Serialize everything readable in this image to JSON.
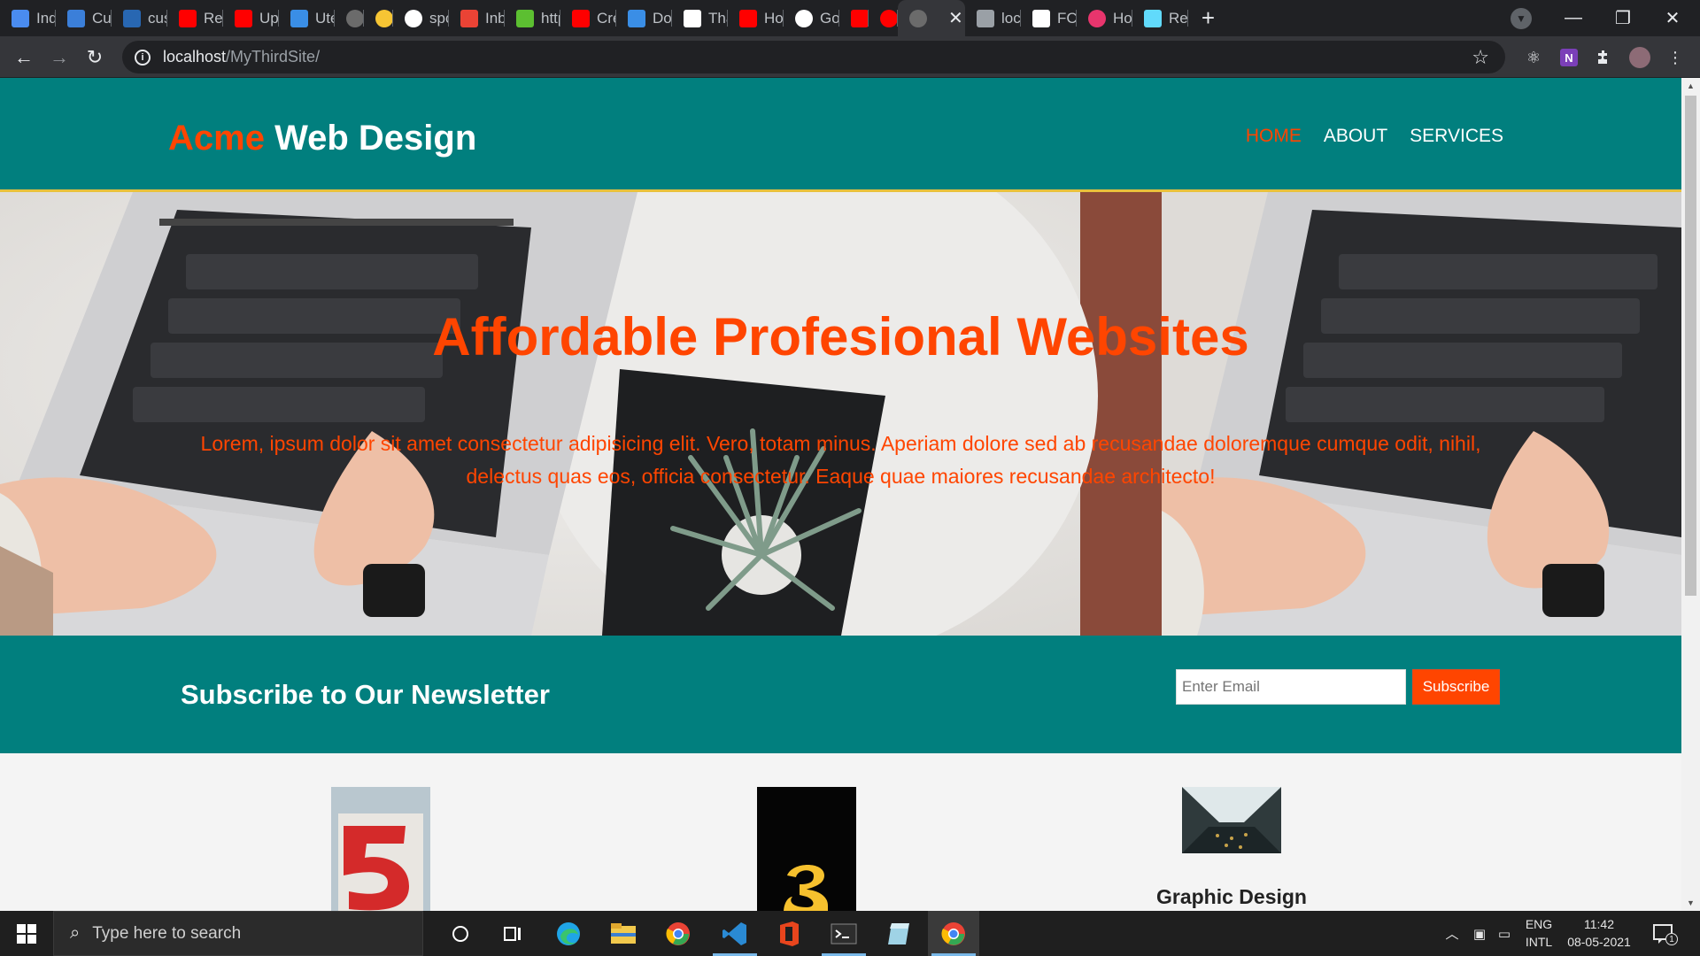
{
  "browser": {
    "tabs": [
      {
        "label": "Inde",
        "icon": "info-icon",
        "color": "#4a8cf0"
      },
      {
        "label": "Cus",
        "icon": "trello-icon",
        "color": "#3b7fd9"
      },
      {
        "label": "cust",
        "icon": "linkedin-icon",
        "color": "#2867b2"
      },
      {
        "label": "Rea",
        "icon": "youtube-icon",
        "color": "#ff0000"
      },
      {
        "label": "Upc",
        "icon": "youtube-icon",
        "color": "#ff0000"
      },
      {
        "label": "Ute",
        "icon": "flag-icon",
        "color": "#3a8ee6"
      },
      {
        "label": "",
        "icon": "globe-icon",
        "color": "#6b6b6b"
      },
      {
        "label": "",
        "icon": "emoji-icon",
        "color": "#f6c534"
      },
      {
        "label": "spo",
        "icon": "spotify-icon",
        "color": "#ffffff"
      },
      {
        "label": "Inb",
        "icon": "gmail-icon",
        "color": "#ea4335"
      },
      {
        "label": "http",
        "icon": "evernote-icon",
        "color": "#5cbf31"
      },
      {
        "label": "Cre",
        "icon": "youtube-icon",
        "color": "#ff0000"
      },
      {
        "label": "Dov",
        "icon": "flag-icon",
        "color": "#3a8ee6"
      },
      {
        "label": "Tha",
        "icon": "doc-icon",
        "color": "#ffffff"
      },
      {
        "label": "Hov",
        "icon": "youtube-icon",
        "color": "#ff0000"
      },
      {
        "label": "Goo",
        "icon": "google-icon",
        "color": "#ffffff"
      },
      {
        "label": "",
        "icon": "youtube-icon",
        "color": "#ff0000"
      },
      {
        "label": "",
        "icon": "record-icon",
        "color": "#ff0000"
      },
      {
        "label": "",
        "icon": "globe-icon",
        "color": "#6b6b6b",
        "active": true
      },
      {
        "label": "loca",
        "icon": "react-icon",
        "color": "#9aa0a6"
      },
      {
        "label": "FCC",
        "icon": "fcc-icon",
        "color": "#ffffff"
      },
      {
        "label": "Hov",
        "icon": "play-icon",
        "color": "#e8356d"
      },
      {
        "label": "Rea",
        "icon": "react-icon",
        "color": "#61dafb"
      }
    ],
    "url_host": "localhost",
    "url_path": "/MyThirdSite/"
  },
  "site": {
    "brand_highlight": "Acme",
    "brand_rest": " Web Design",
    "nav": [
      {
        "label": "HOME",
        "current": true
      },
      {
        "label": "ABOUT",
        "current": false
      },
      {
        "label": "SERVICES",
        "current": false
      }
    ],
    "showcase": {
      "title": "Affordable Profesional Websites",
      "text": "Lorem, ipsum dolor sit amet consectetur adipisicing elit. Vero, totam minus. Aperiam dolore sed ab recusandae doloremque cumque odit, nihil, delectus quas eos, officia consectetur. Eaque quae maiores recusandae architecto!"
    },
    "newsletter": {
      "title": "Subscribe to Our Newsletter",
      "placeholder": "Enter Email",
      "button": "Subscribe"
    },
    "boxes": [
      {
        "title": ""
      },
      {
        "title": ""
      },
      {
        "title": "Graphic Design"
      }
    ],
    "accent_color": "#ff4500",
    "primary_color": "#017f7e"
  },
  "taskbar": {
    "search_placeholder": "Type here to search",
    "lang_line1": "ENG",
    "lang_line2": "INTL",
    "time": "11:42",
    "date": "08-05-2021",
    "notification_count": "1"
  }
}
